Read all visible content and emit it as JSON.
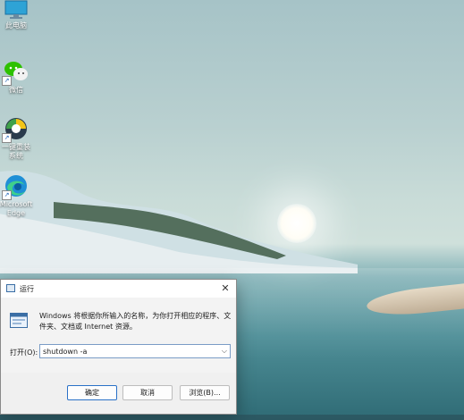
{
  "desktop": {
    "icons": [
      {
        "label_line1": "此电脑",
        "label_line2": ""
      },
      {
        "label_line1": "微信",
        "label_line2": ""
      },
      {
        "label_line1": "一键重装",
        "label_line2": "系统"
      },
      {
        "label_line1": "Microsoft",
        "label_line2": "Edge"
      }
    ]
  },
  "run_dialog": {
    "title": "运行",
    "close_glyph": "✕",
    "description": "Windows 将根据你所输入的名称，为你打开相应的程序、文件夹、文档或 Internet 资源。",
    "open_label": "打开(O):",
    "input_value": "shutdown -a",
    "dropdown_glyph": "⌵",
    "ok_label": "确定",
    "cancel_label": "取消",
    "browse_label": "浏览(B)..."
  }
}
